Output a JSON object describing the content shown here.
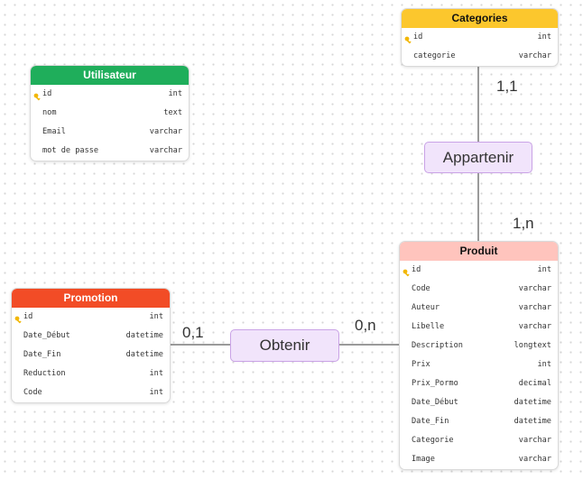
{
  "entities": {
    "categories": {
      "title": "Categories",
      "fields": [
        {
          "name": "id",
          "type": "int",
          "pk": true
        },
        {
          "name": "categorie",
          "type": "varchar"
        }
      ]
    },
    "utilisateur": {
      "title": "Utilisateur",
      "fields": [
        {
          "name": "id",
          "type": "int",
          "pk": true
        },
        {
          "name": "nom",
          "type": "text"
        },
        {
          "name": "Email",
          "type": "varchar"
        },
        {
          "name": "mot de passe",
          "type": "varchar"
        }
      ]
    },
    "promotion": {
      "title": "Promotion",
      "fields": [
        {
          "name": "id",
          "type": "int",
          "pk": true
        },
        {
          "name": "Date_Début",
          "type": "datetime"
        },
        {
          "name": "Date_Fin",
          "type": "datetime"
        },
        {
          "name": "Reduction",
          "type": "int"
        },
        {
          "name": "Code",
          "type": "int"
        }
      ]
    },
    "produit": {
      "title": "Produit",
      "fields": [
        {
          "name": "id",
          "type": "int",
          "pk": true
        },
        {
          "name": "Code",
          "type": "varchar"
        },
        {
          "name": "Auteur",
          "type": "varchar"
        },
        {
          "name": "Libelle",
          "type": "varchar"
        },
        {
          "name": "Description",
          "type": "longtext"
        },
        {
          "name": "Prix",
          "type": "int"
        },
        {
          "name": "Prix_Pormo",
          "type": "decimal"
        },
        {
          "name": "Date_Début",
          "type": "datetime"
        },
        {
          "name": "Date_Fin",
          "type": "datetime"
        },
        {
          "name": "Categorie",
          "type": "varchar"
        },
        {
          "name": "Image",
          "type": "varchar"
        }
      ]
    }
  },
  "relations": {
    "appartenir": {
      "label": "Appartenir",
      "card_top": "1,1",
      "card_bottom": "1,n"
    },
    "obtenir": {
      "label": "Obtenir",
      "card_left": "0,1",
      "card_right": "0,n"
    }
  },
  "colors": {
    "categories_header": "#fcc72d",
    "utilisateur_header": "#1fae5b",
    "promotion_header": "#f24c26",
    "produit_header": "#ffc4bd",
    "relation_fill": "#f1e4fb",
    "key_icon": "#f2b705"
  }
}
